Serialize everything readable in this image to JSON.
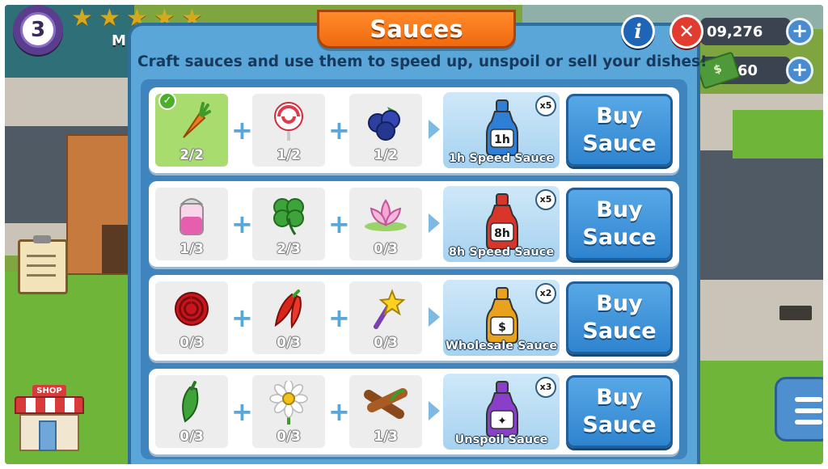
{
  "hud": {
    "level": "3",
    "stars": 5,
    "name_fragment": "M",
    "coins": "09,276",
    "cash": "60",
    "plus": "+",
    "shop_sign": "SHOP"
  },
  "dialog": {
    "title": "Sauces",
    "info": "i",
    "close": "✕",
    "subtitle": "Craft sauces and use them to speed up, unspoil or sell your dishes!"
  },
  "plus_symbol": "+",
  "recipes": [
    {
      "ingredients": [
        {
          "icon": "carrot-icon",
          "count": "2/2",
          "complete": true
        },
        {
          "icon": "lollipop-icon",
          "count": "1/2",
          "complete": false
        },
        {
          "icon": "blueberries-icon",
          "count": "1/2",
          "complete": false
        }
      ],
      "result": {
        "name": "1h Speed Sauce",
        "multiplier": "x5",
        "label": "1h",
        "color": "#2f7fd6"
      },
      "buy": {
        "line1": "Buy",
        "line2": "Sauce"
      }
    },
    {
      "ingredients": [
        {
          "icon": "salt-shaker-icon",
          "count": "1/3",
          "complete": false
        },
        {
          "icon": "clover-icon",
          "count": "2/3",
          "complete": false
        },
        {
          "icon": "lotus-icon",
          "count": "0/3",
          "complete": false
        }
      ],
      "result": {
        "name": "8h Speed Sauce",
        "multiplier": "x5",
        "label": "8h",
        "color": "#d9362b"
      },
      "buy": {
        "line1": "Buy",
        "line2": "Sauce"
      }
    },
    {
      "ingredients": [
        {
          "icon": "rose-icon",
          "count": "0/3",
          "complete": false
        },
        {
          "icon": "chili-peppers-icon",
          "count": "0/3",
          "complete": false
        },
        {
          "icon": "magic-wand-icon",
          "count": "0/3",
          "complete": false
        }
      ],
      "result": {
        "name": "Wholesale Sauce",
        "multiplier": "x2",
        "label": "$",
        "color": "#e8a21d"
      },
      "buy": {
        "line1": "Buy",
        "line2": "Sauce"
      }
    },
    {
      "ingredients": [
        {
          "icon": "green-pepper-icon",
          "count": "0/3",
          "complete": false
        },
        {
          "icon": "daisy-icon",
          "count": "0/3",
          "complete": false
        },
        {
          "icon": "cinnamon-icon",
          "count": "1/3",
          "complete": false
        }
      ],
      "result": {
        "name": "Unspoil Sauce",
        "multiplier": "x3",
        "label": "✦",
        "color": "#8a3fc9"
      },
      "buy": {
        "line1": "Buy",
        "line2": "Sauce"
      }
    }
  ]
}
